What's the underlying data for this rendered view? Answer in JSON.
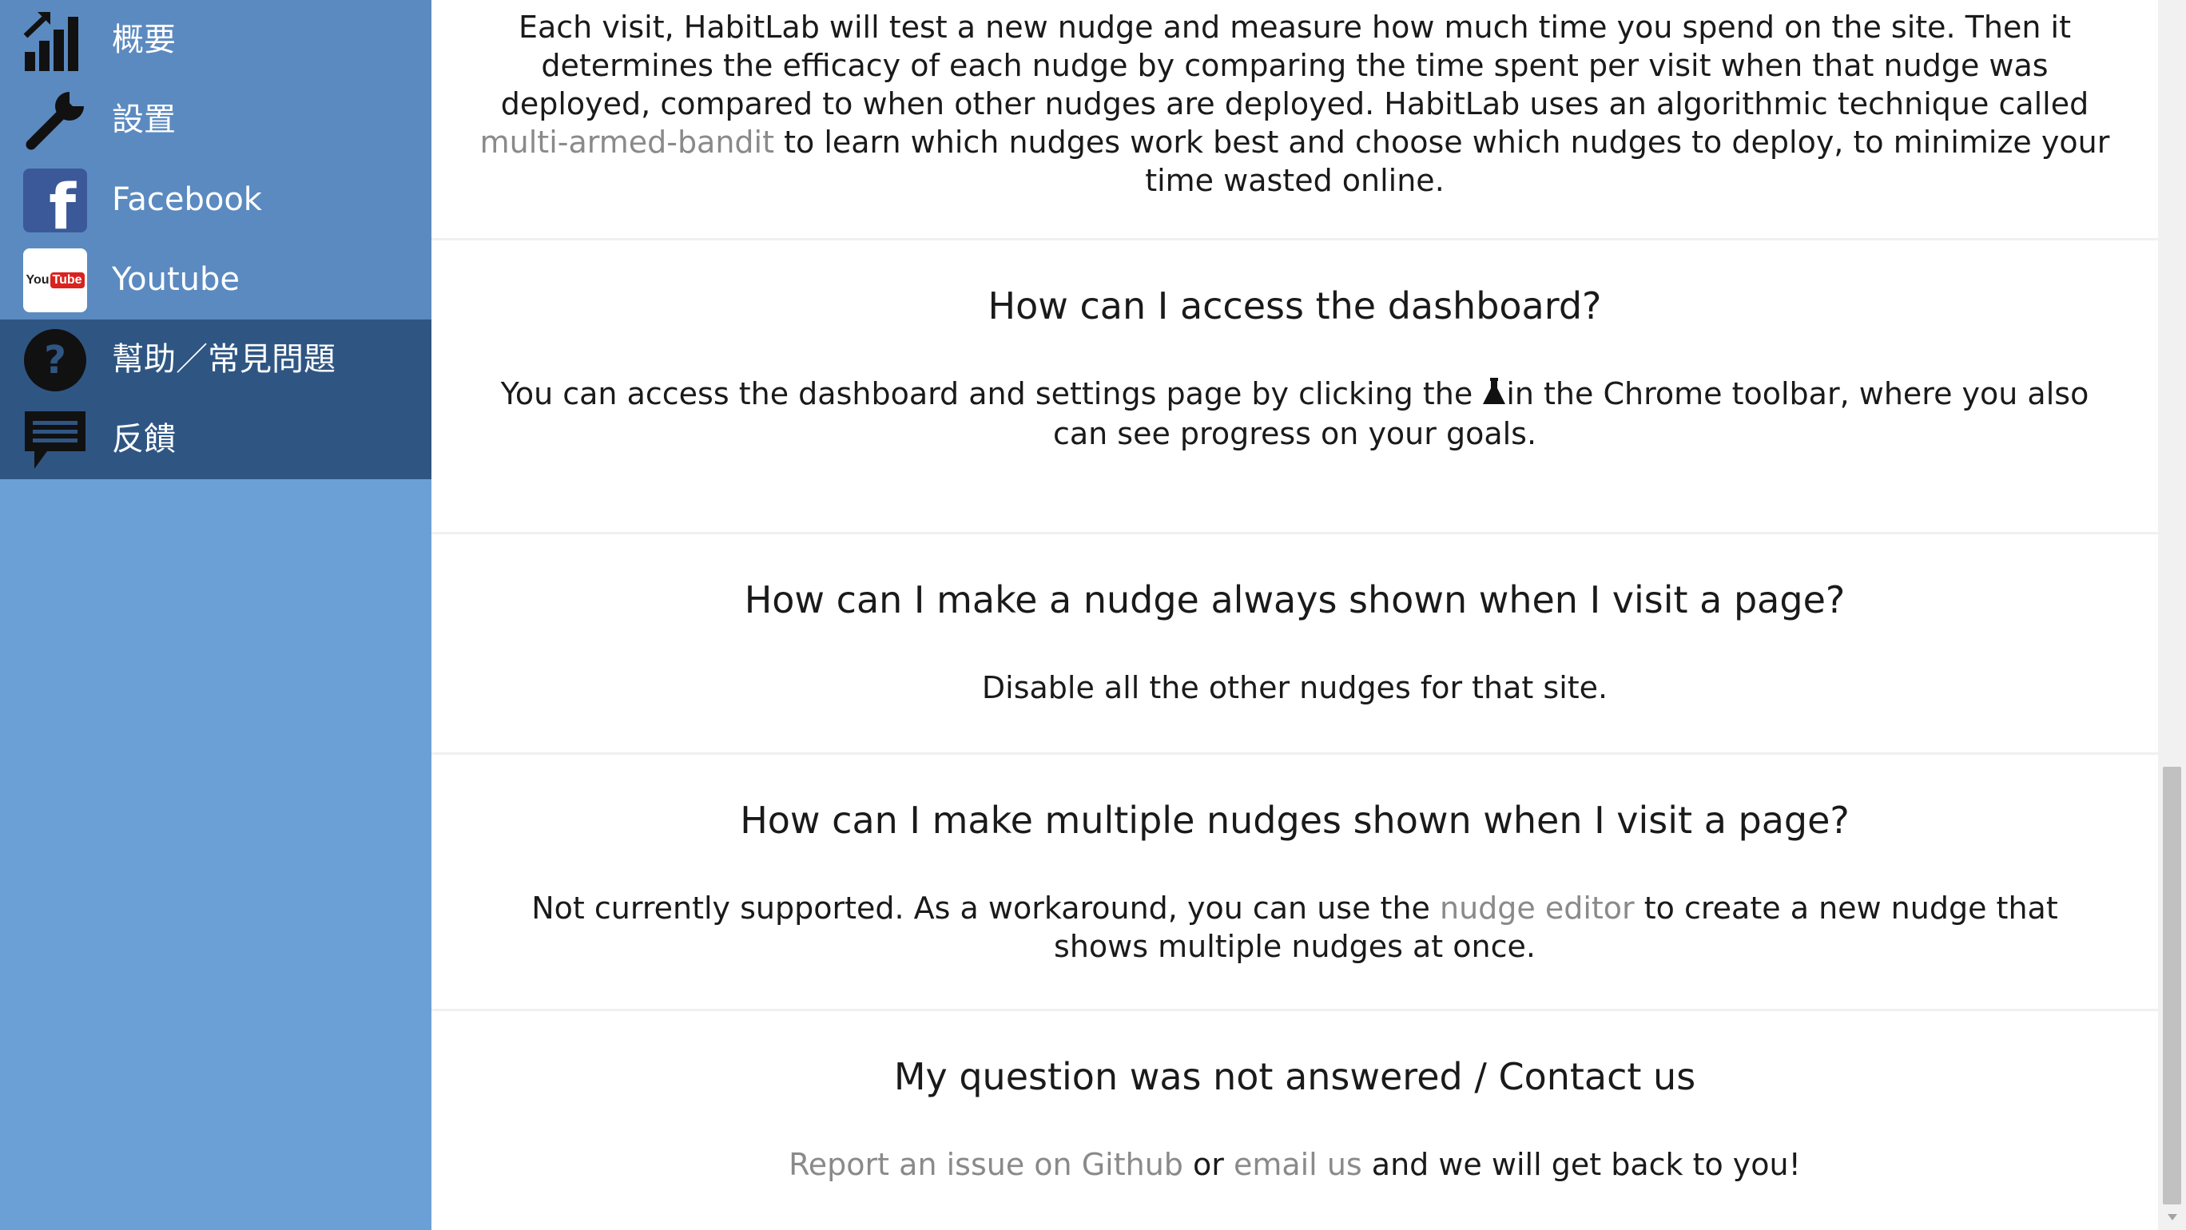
{
  "sidebar": {
    "items": [
      {
        "label": "概要",
        "icon": "bar-chart-icon"
      },
      {
        "label": "設置",
        "icon": "wrench-icon"
      },
      {
        "label": "Facebook",
        "icon": "facebook-icon"
      },
      {
        "label": "Youtube",
        "icon": "youtube-icon"
      },
      {
        "label": "幫助／常見問題",
        "icon": "help-icon"
      },
      {
        "label": "反饋",
        "icon": "feedback-icon"
      }
    ],
    "youtube_logo": {
      "you": "You",
      "tube": "Tube"
    },
    "facebook_logo": "f"
  },
  "faq": {
    "intro": {
      "text_1": "Each visit, HabitLab will test a new nudge and measure how much time you spend on the site. Then it determines the efficacy of each nudge by comparing the time spent per visit when that nudge was deployed, compared to when other nudges are deployed. HabitLab uses an algorithmic technique called ",
      "link": "multi-armed-bandit",
      "text_2": " to learn which nudges work best and choose which nudges to deploy, to minimize your time wasted online."
    },
    "dashboard": {
      "question": "How can I access the dashboard?",
      "answer_1": "You can access the dashboard and settings page by clicking the ",
      "answer_2": "in the Chrome toolbar, where you also can see progress on your goals."
    },
    "always_shown": {
      "question": "How can I make a nudge always shown when I visit a page?",
      "answer": "Disable all the other nudges for that site."
    },
    "multiple": {
      "question": "How can I make multiple nudges shown when I visit a page?",
      "answer_1": "Not currently supported. As a workaround, you can use the ",
      "link": "nudge editor",
      "answer_2": " to create a new nudge that shows multiple nudges at once."
    },
    "contact": {
      "question": "My question was not answered / Contact us",
      "link_1": "Report an issue on Github",
      "or": " or ",
      "link_2": "email us",
      "answer_end": " and we will get back to you!"
    }
  },
  "colors": {
    "sidebar_bg": "#6ba0d6",
    "sidebar_top_group": "#5b8ac0",
    "sidebar_bottom_group": "#2f5683",
    "link": "#8a8a8a",
    "text": "#1a1a1a"
  }
}
